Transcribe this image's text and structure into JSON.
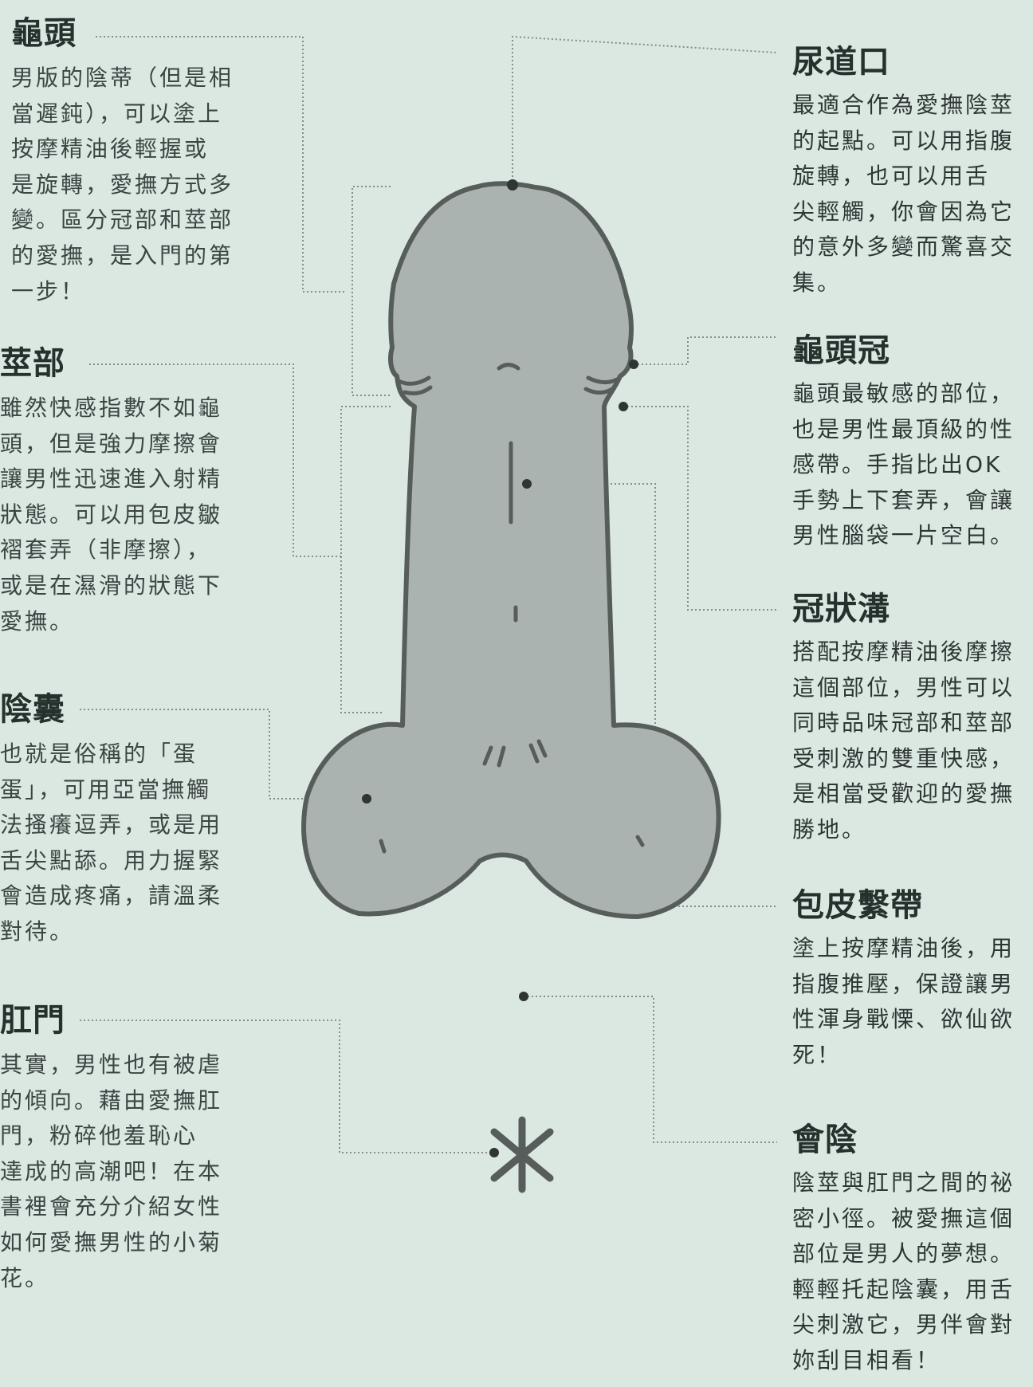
{
  "left": [
    {
      "title": "龜頭",
      "body": "男版的陰蒂（但是相\n當遲鈍），可以塗上\n按摩精油後輕握或\n是旋轉，愛撫方式多\n變。區分冠部和莖部\n的愛撫，是入門的第\n一步！"
    },
    {
      "title": "莖部",
      "body": "雖然快感指數不如龜\n頭，但是強力摩擦會\n讓男性迅速進入射精\n狀態。可以用包皮皺\n褶套弄（非摩擦），\n或是在濕滑的狀態下\n愛撫。"
    },
    {
      "title": "陰囊",
      "body": "也就是俗稱的「蛋\n蛋」，可用亞當撫觸\n法搔癢逗弄，或是用\n舌尖點舔。用力握緊\n會造成疼痛，請溫柔\n對待。"
    },
    {
      "title": "肛門",
      "body": "其實，男性也有被虐\n的傾向。藉由愛撫肛\n門，粉碎他羞恥心\n達成的高潮吧！在本\n書裡會充分介紹女性\n如何愛撫男性的小菊\n花。"
    }
  ],
  "right": [
    {
      "title": "尿道口",
      "body": "最適合作為愛撫陰莖\n的起點。可以用指腹\n旋轉，也可以用舌\n尖輕觸，你會因為它\n的意外多變而驚喜交\n集。"
    },
    {
      "title": "龜頭冠",
      "body": "龜頭最敏感的部位，\n也是男性最頂級的性\n感帶。手指比出OK\n手勢上下套弄，會讓\n男性腦袋一片空白。"
    },
    {
      "title": "冠狀溝",
      "body": "搭配按摩精油後摩擦\n這個部位，男性可以\n同時品味冠部和莖部\n受刺激的雙重快感，\n是相當受歡迎的愛撫\n勝地。"
    },
    {
      "title": "包皮繫帶",
      "body": "塗上按摩精油後，用\n指腹推壓，保證讓男\n性渾身戰慄、欲仙欲\n死！"
    },
    {
      "title": "會陰",
      "body": "陰莖與肛門之間的祕\n密小徑。被愛撫這個\n部位是男人的夢想。\n輕輕托起陰囊，用舌\n尖刺激它，男伴會對\n妳刮目相看！"
    }
  ],
  "colors": {
    "background": "#dbe8e2",
    "organ_fill": "#aab3b0",
    "outline": "#575d5b",
    "leader": "#858c89"
  }
}
